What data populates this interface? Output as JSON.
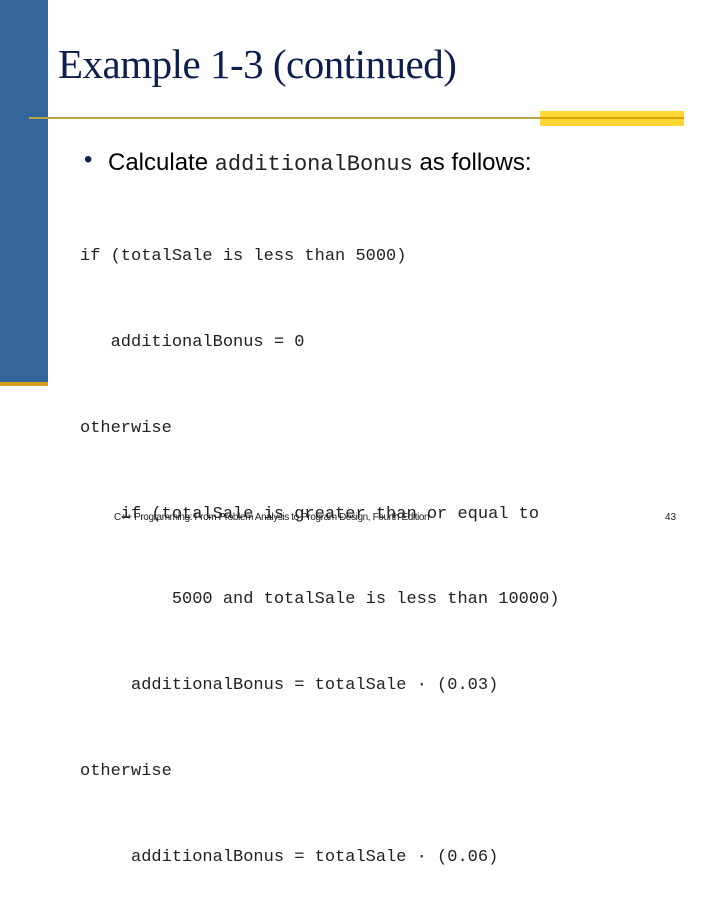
{
  "slide": {
    "title": "Example 1-3 (continued)",
    "bullet": {
      "prefix": "Calculate",
      "code_term": "additionalBonus",
      "suffix": "as follows:"
    },
    "code_lines": [
      "if (totalSale is less than 5000)",
      "   additionalBonus = 0",
      "otherwise",
      "    if (totalSale is greater than or equal to",
      "         5000 and totalSale is less than 10000)",
      "     additionalBonus = totalSale · (0.03)",
      "otherwise",
      "     additionalBonus = totalSale · (0.06)"
    ],
    "footer": "C++ Programming: From Problem Analysis to Program Design, Fourth Edition",
    "page_number": "43"
  },
  "colors": {
    "left_bar": "#336699",
    "accent_gold": "#fdd835",
    "title_text": "#0d1f4f"
  }
}
